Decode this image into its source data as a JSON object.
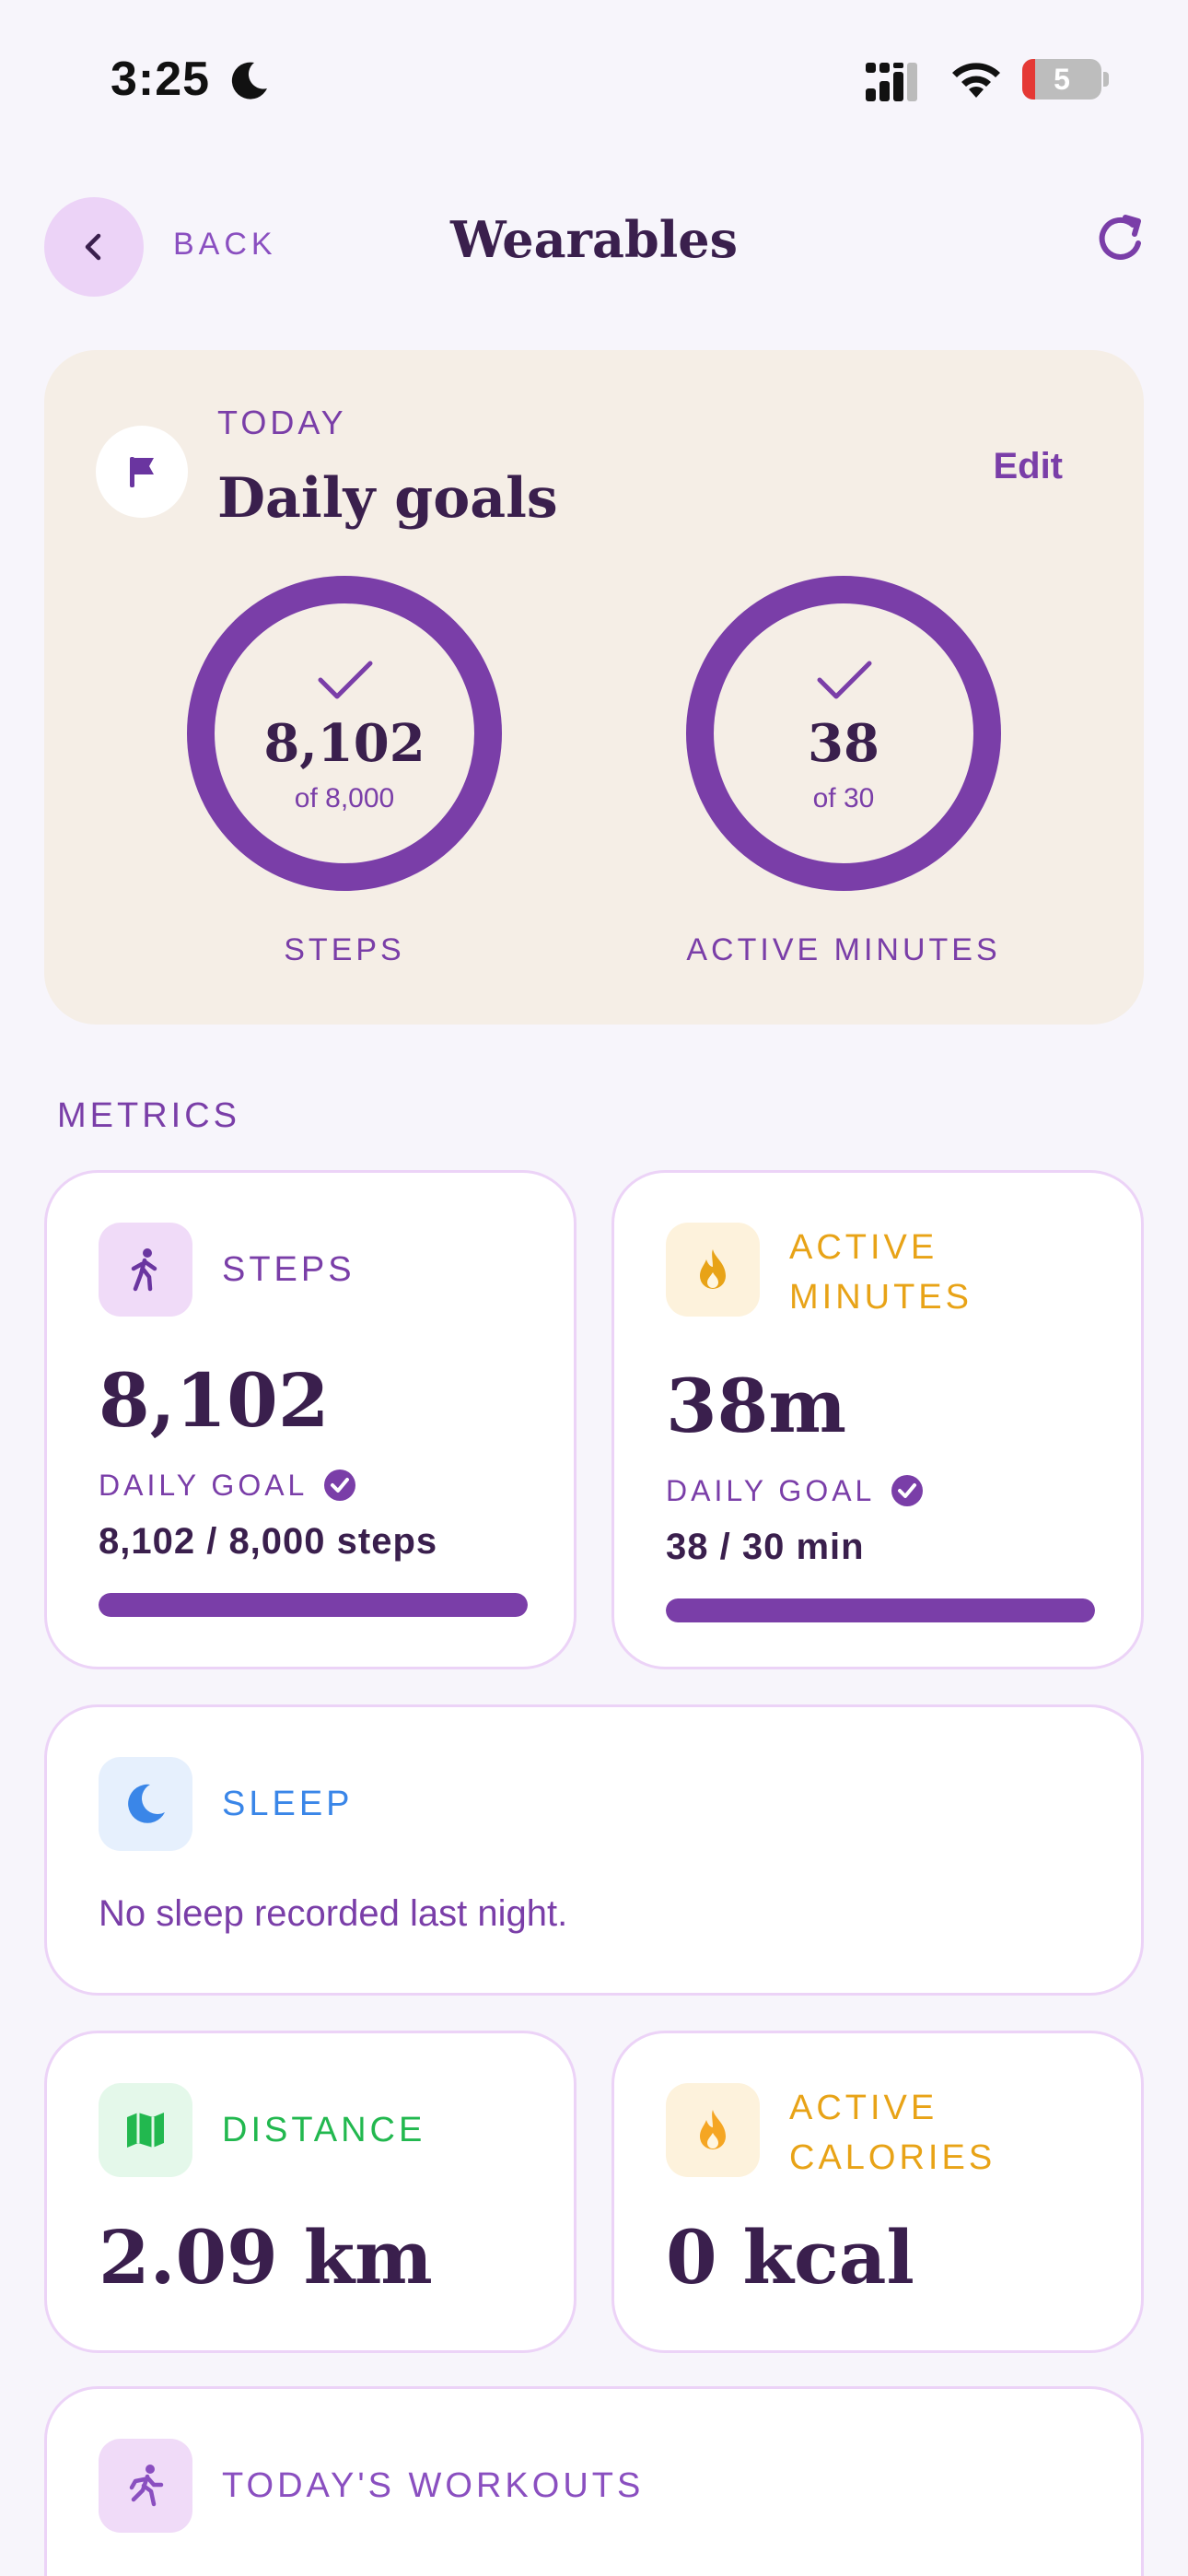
{
  "status_bar": {
    "time": "3:25",
    "battery_level": "5"
  },
  "header": {
    "back_label": "BACK",
    "title": "Wearables"
  },
  "daily_goals": {
    "overline": "TODAY",
    "title": "Daily goals",
    "edit_label": "Edit",
    "rings": [
      {
        "value": "8,102",
        "sub": "of 8,000",
        "label": "STEPS",
        "progress": 1.0
      },
      {
        "value": "38",
        "sub": "of 30",
        "label": "ACTIVE MINUTES",
        "progress": 1.0
      }
    ]
  },
  "metrics": {
    "section_label": "METRICS",
    "steps": {
      "label": "STEPS",
      "value": "8,102",
      "goal_label": "DAILY GOAL",
      "goal_text": "8,102 / 8,000 steps",
      "progress": 1.0
    },
    "active_minutes": {
      "label_line1": "ACTIVE",
      "label_line2": "MINUTES",
      "value": "38m",
      "goal_label": "DAILY GOAL",
      "goal_text": "38 / 30 min",
      "progress": 1.0
    },
    "sleep": {
      "label": "SLEEP",
      "message": "No sleep recorded last night."
    },
    "distance": {
      "label": "DISTANCE",
      "value": "2.09 km"
    },
    "active_calories": {
      "label_line1": "ACTIVE",
      "label_line2": "CALORIES",
      "value": "0 kcal"
    },
    "workouts": {
      "label": "TODAY'S WORKOUTS"
    }
  },
  "colors": {
    "primary": "#7a3ea8",
    "dark_text": "#3a1f4d",
    "amber": "#e8a317",
    "blue": "#3a86e8",
    "green": "#22b84f",
    "card_border": "#ecd3f7",
    "goals_bg": "#f5eee6"
  }
}
